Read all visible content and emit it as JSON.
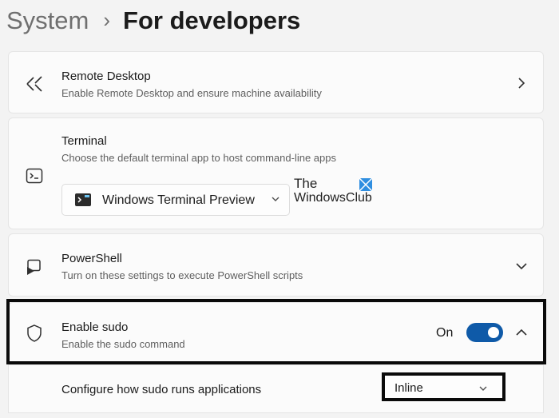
{
  "breadcrumb": {
    "parent": "System",
    "separator": "›",
    "current": "For developers"
  },
  "settings": {
    "remote_desktop": {
      "title": "Remote Desktop",
      "description": "Enable Remote Desktop and ensure machine availability",
      "icon": "remote-desktop-icon"
    },
    "terminal": {
      "title": "Terminal",
      "description": "Choose the default terminal app to host command-line apps",
      "icon": "terminal-icon",
      "selected_app": "Windows Terminal Preview"
    },
    "powershell": {
      "title": "PowerShell",
      "description": "Turn on these settings to execute PowerShell scripts",
      "icon": "powershell-icon"
    },
    "sudo": {
      "title": "Enable sudo",
      "description": "Enable the sudo command",
      "icon": "shield-icon",
      "toggle_label": "On",
      "toggle_on": true,
      "sub_setting": {
        "label": "Configure how sudo runs applications",
        "selected": "Inline"
      }
    }
  },
  "watermark": {
    "line1": "The",
    "line2": "WindowsClub"
  },
  "colors": {
    "accent": "#0f5aa8",
    "background": "#f3f3f3",
    "card": "#fbfbfb",
    "highlight": "#0a0a0a"
  }
}
